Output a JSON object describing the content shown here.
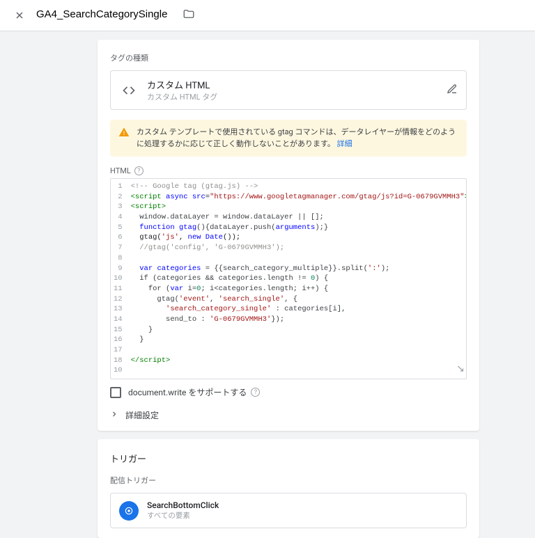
{
  "header": {
    "title": "GA4_SearchCategorySingle"
  },
  "tag": {
    "section_label": "タグの種類",
    "type_title": "カスタム HTML",
    "type_sub": "カスタム HTML タグ",
    "warning_text": "カスタム テンプレートで使用されている gtag コマンドは、データレイヤーが情報をどのように処理するかに応じて正しく動作しないことがあります。",
    "warning_link": "詳細",
    "html_label": "HTML",
    "doc_write_label": "document.write をサポートする",
    "advanced_label": "詳細設定"
  },
  "code": {
    "async_attr": "async",
    "src_attr": "src",
    "src_url": "\"https://www.googletagmanager.com/gtag/js?id=G-0679GVMMH3\"",
    "comment_google": "<!-- Google tag (gtag.js) -->",
    "l4": "  window.dataLayer = window.dataLayer || [];",
    "gtag_name": "gtag",
    "l5_body": "(){dataLayer.push(",
    "l5_arguments": "arguments",
    "l5_tail": ");}",
    "l6_gtag_args": "'js'",
    "l6_date": "Date",
    "l7_comment": "//gtag('config', 'G-0679GVMMH3');",
    "l9_var": "categories",
    "l9_rhs": " = {{search_category_multiple}}.split(",
    "l9_colon": "':'",
    "l9_tail": ");",
    "l10": "  if (categories && categories.length != ",
    "l10_zero": "0",
    "l10_tail": ") {",
    "l11_a": "    for (",
    "l11_var": "var",
    "l11_b": " i=",
    "l11_zero": "0",
    "l11_c": "; i<categories.length; i++) {",
    "l12_a": "      gtag(",
    "l12_evt": "'event'",
    "l12_b": ", ",
    "l12_name": "'search_single'",
    "l12_c": ", {",
    "l13_a": "        ",
    "l13_key": "'search_category_single'",
    "l13_b": " : categories[i],",
    "l14_a": "        send_to : ",
    "l14_val": "'G-0679GVMMH3'",
    "l14_b": "});",
    "l15": "    }",
    "l16": "  }",
    "script_open": "<script>",
    "script_close_token": "script>"
  },
  "triggers": {
    "section_label": "トリガー",
    "sub_label": "配信トリガー",
    "item_title": "SearchBottomClick",
    "item_sub": "すべての要素"
  }
}
